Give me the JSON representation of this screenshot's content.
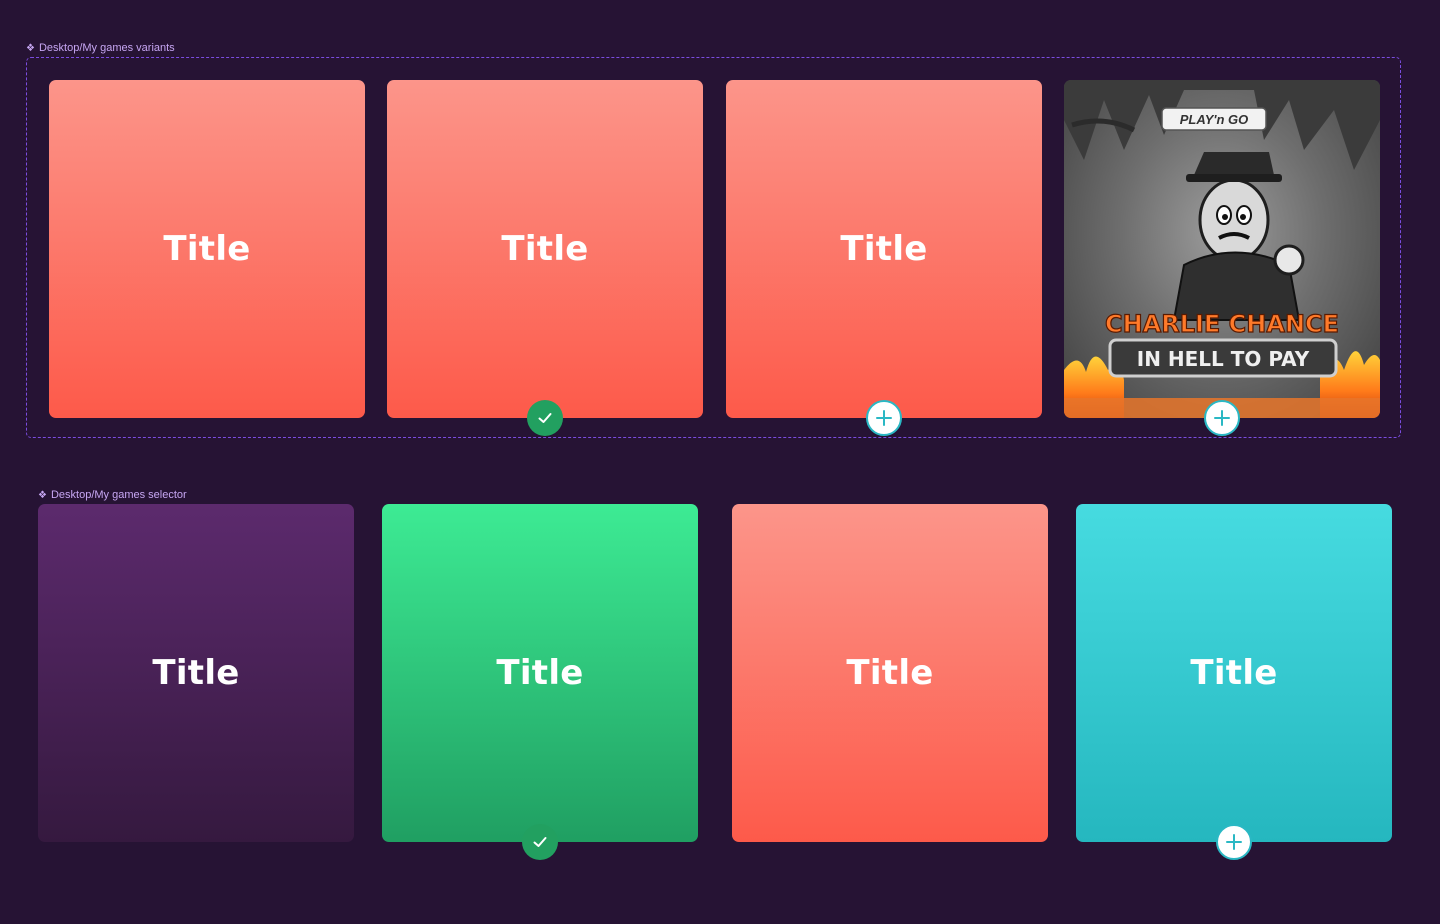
{
  "variants": {
    "label": "Desktop/My games variants",
    "cards": [
      {
        "title": "Title",
        "color": "coral",
        "badge": "none"
      },
      {
        "title": "Title",
        "color": "coral",
        "badge": "check"
      },
      {
        "title": "Title",
        "color": "coral",
        "badge": "plus"
      },
      {
        "title": "",
        "color": "image",
        "badge": "plus",
        "image": {
          "brand": "PLAY'n GO",
          "game_name_1": "CHARLIE CHANCE",
          "game_name_2": "IN HELL TO PAY"
        }
      }
    ]
  },
  "selector": {
    "label": "Desktop/My games selector",
    "cards": [
      {
        "title": "Title",
        "color": "purple",
        "badge": "none"
      },
      {
        "title": "Title",
        "color": "green",
        "badge": "check"
      },
      {
        "title": "Title",
        "color": "coral",
        "badge": "none"
      },
      {
        "title": "Title",
        "color": "teal",
        "badge": "plus"
      }
    ]
  },
  "colors": {
    "background": "#261334",
    "frame_border": "#7b4ce0",
    "label": "#c6a6f2",
    "check_badge": "#22a060",
    "plus_badge_ring": "#2ab8c4",
    "coral_top": "#fc958a",
    "coral_bottom": "#fd5a4a",
    "purple_top": "#5c2a6d",
    "purple_bottom": "#35193f",
    "green_top": "#3deb94",
    "green_bottom": "#209f62",
    "teal_top": "#46dbe0",
    "teal_bottom": "#25b7bf"
  },
  "icons": {
    "component": "component-diamond-icon",
    "check": "check-icon",
    "plus": "plus-icon"
  }
}
